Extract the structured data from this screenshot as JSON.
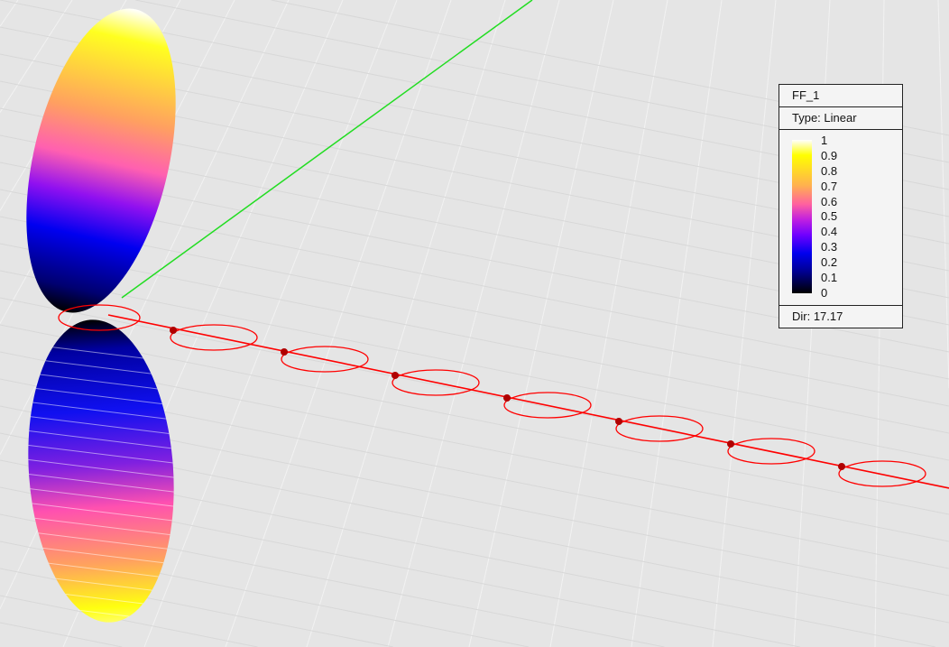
{
  "legend": {
    "title": "FF_1",
    "type": "Type: Linear",
    "ticks": [
      "1",
      "0.9",
      "0.8",
      "0.7",
      "0.6",
      "0.5",
      "0.4",
      "0.3",
      "0.2",
      "0.1",
      "0"
    ],
    "footer": "Dir: 17.17"
  },
  "colors": {
    "background": "#e5e5e5",
    "antenna": "#ff0000",
    "axis": "#22dd22"
  }
}
